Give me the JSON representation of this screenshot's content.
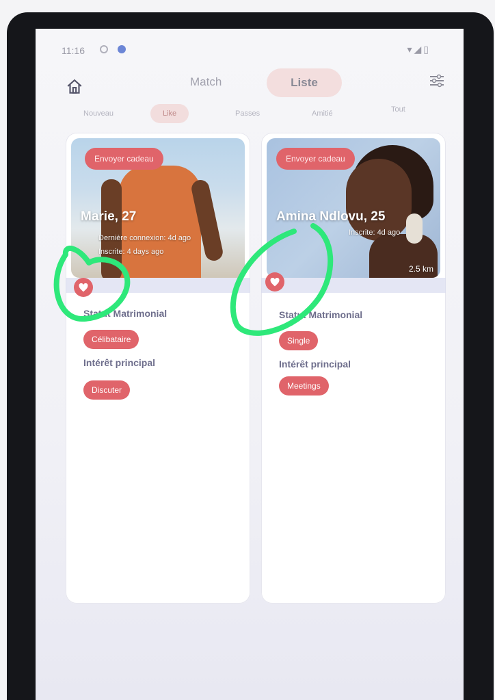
{
  "statusbar": {
    "time": "11:16"
  },
  "topnav": {
    "match_label": "Match",
    "liste_label": "Liste"
  },
  "subtabs": [
    "Nouveau",
    "Like",
    "Passes",
    "Amitié",
    "Tout"
  ],
  "cards": [
    {
      "gift_label": "Envoyer cadeau",
      "name": "Marie, 27",
      "line1": "Dernière connexion: 4d ago",
      "line2": "Inscrite: 4 days ago",
      "marital_label": "Statut Matrimonial",
      "marital_value": "Célibataire",
      "interest_label": "Intérêt principal",
      "interest_value": "Discuter"
    },
    {
      "gift_label": "Envoyer cadeau",
      "name": "Amina Ndlovu, 25",
      "line1": "Inscrite: 4d ago",
      "distance": "2.5 km",
      "marital_label": "Statut Matrimonial",
      "marital_value": "Single",
      "interest_label": "Intérêt principal",
      "interest_value": "Meetings"
    }
  ],
  "colors": {
    "accent": "#e0646a",
    "annotation": "#2ee87a",
    "bezel": "#15161a"
  }
}
